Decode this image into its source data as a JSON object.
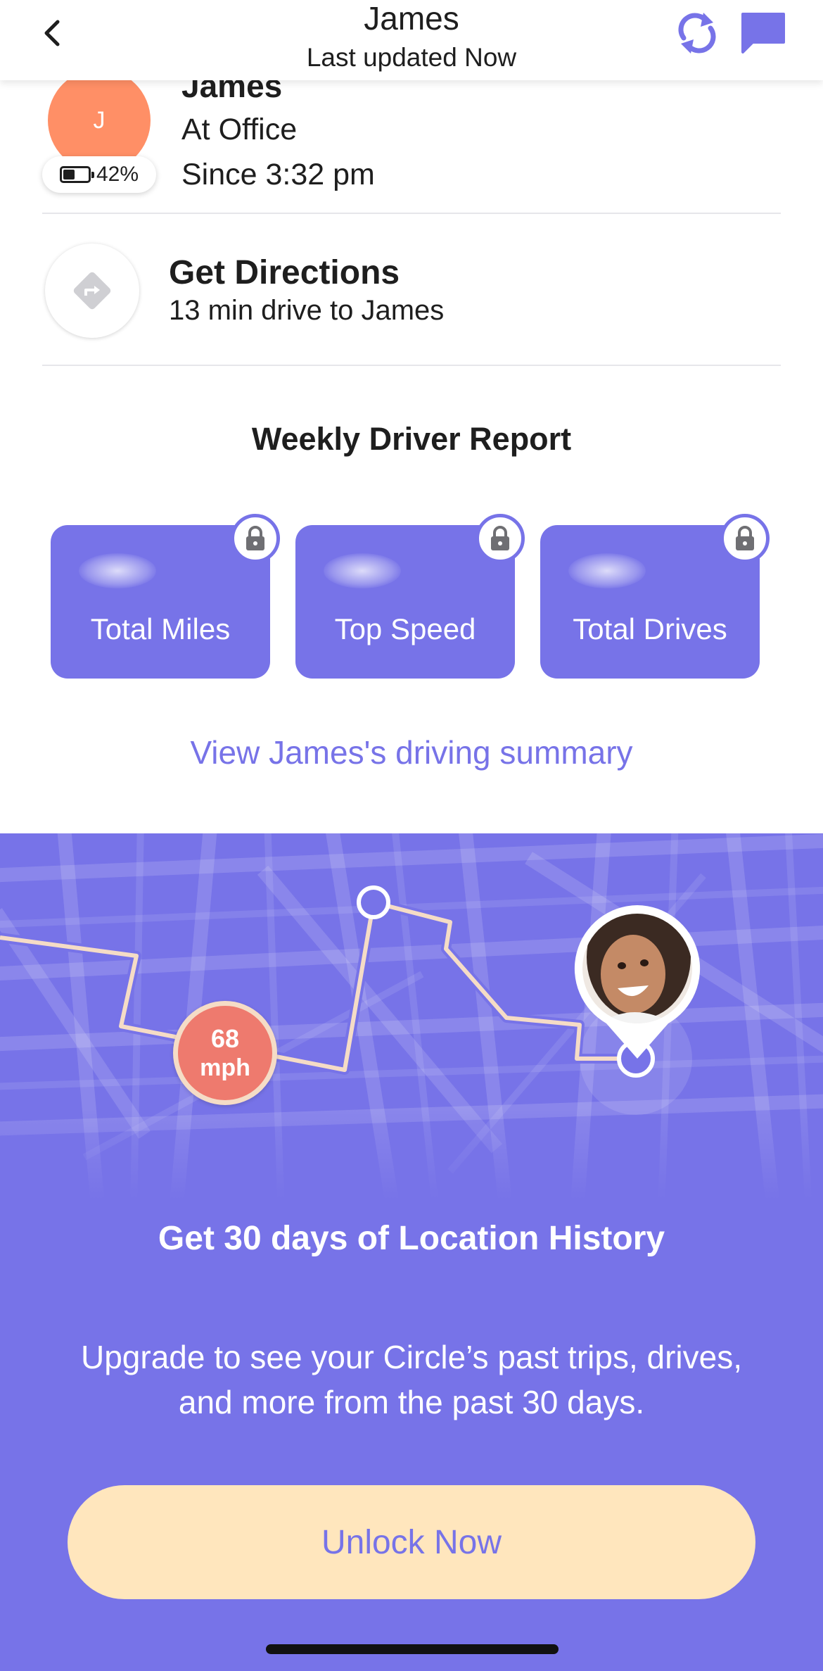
{
  "header": {
    "title": "James",
    "subtitle": "Last updated Now"
  },
  "member": {
    "initial": "J",
    "name": "James",
    "place": "At Office",
    "since": "Since 3:32 pm",
    "battery_label": "42%",
    "battery_level": 0.42,
    "avatar_color": "#ff8f66"
  },
  "directions": {
    "title": "Get Directions",
    "subtitle": "13 min drive to James"
  },
  "report": {
    "title": "Weekly Driver Report",
    "cards": [
      {
        "label": "Total Miles",
        "locked": true
      },
      {
        "label": "Top Speed",
        "locked": true
      },
      {
        "label": "Total Drives",
        "locked": true
      }
    ],
    "link": "View James's driving summary"
  },
  "promo": {
    "speed_value": "68",
    "speed_unit": "mph",
    "title": "Get 30 days of Location History",
    "body": "Upgrade to see your Circle’s past trips, drives, and more from the past 30 days.",
    "button": "Unlock Now"
  },
  "colors": {
    "accent": "#7773e8",
    "button_bg": "#ffe6bd",
    "speed_badge": "#ee7a6e",
    "route": "#f5dcc6"
  },
  "icons": {
    "back": "chevron-left-icon",
    "refresh": "refresh-icon",
    "chat": "chat-icon",
    "directions": "directions-diamond-icon",
    "lock": "lock-icon",
    "battery": "battery-icon"
  }
}
